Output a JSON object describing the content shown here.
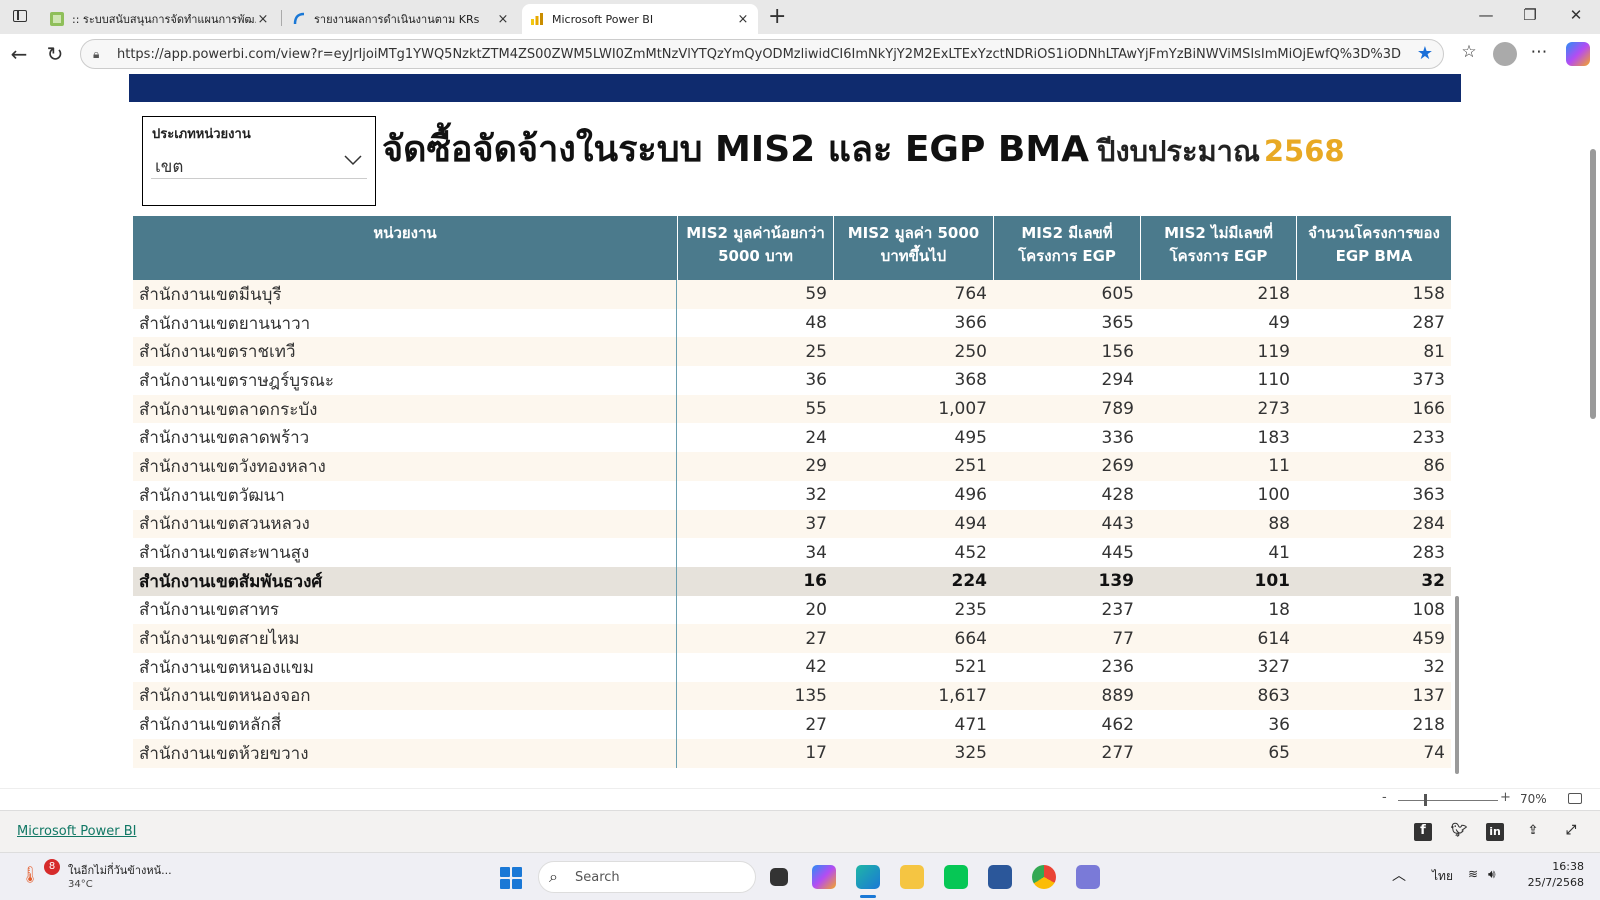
{
  "browser": {
    "tabs": [
      {
        "title": ":: ระบบสนับสนุนการจัดทำแผนการพัฒ...",
        "active": false
      },
      {
        "title": "รายงานผลการดำเนินงานตาม KRs",
        "active": false
      },
      {
        "title": "Microsoft Power BI",
        "active": true
      }
    ],
    "new_tab": "+",
    "close": "×",
    "url": "https://app.powerbi.com/view?r=eyJrIjoiMTg1YWQ5NzktZTM4ZS00ZWM5LWI0ZmMtNzVlYTQzYmQyODMzliwidCI6ImNkYjY2M2ExLTExYzctNDRiOS1iODNhLTAwYjFmYzBiNWViMSIsImMiOjEwfQ%3D%3D"
  },
  "slicer": {
    "label": "ประเภทหน่วยงาน",
    "value": "เขต"
  },
  "report_title": {
    "main": "จัดซื้อจัดจ้างในระบบ MIS2 และ EGP BMA",
    "sub": "ปีงบประมาณ",
    "year": "2568"
  },
  "table": {
    "headers": [
      "หน่วยงาน",
      "MIS2 มูลค่าน้อยกว่า 5000 บาท",
      "MIS2 มูลค่า 5000 บาทขึ้นไป",
      "MIS2 มีเลขที่โครงการ EGP",
      "MIS2 ไม่มีเลขที่โครงการ EGP",
      "จำนวนโครงการของ EGP BMA"
    ],
    "rows": [
      {
        "name": "สำนักงานเขตมีนบุรี",
        "v": [
          "59",
          "764",
          "605",
          "218",
          "158"
        ]
      },
      {
        "name": "สำนักงานเขตยานนาวา",
        "v": [
          "48",
          "366",
          "365",
          "49",
          "287"
        ]
      },
      {
        "name": "สำนักงานเขตราชเทวี",
        "v": [
          "25",
          "250",
          "156",
          "119",
          "81"
        ]
      },
      {
        "name": "สำนักงานเขตราษฎร์บูรณะ",
        "v": [
          "36",
          "368",
          "294",
          "110",
          "373"
        ]
      },
      {
        "name": "สำนักงานเขตลาดกระบัง",
        "v": [
          "55",
          "1,007",
          "789",
          "273",
          "166"
        ]
      },
      {
        "name": "สำนักงานเขตลาดพร้าว",
        "v": [
          "24",
          "495",
          "336",
          "183",
          "233"
        ]
      },
      {
        "name": "สำนักงานเขตวังทองหลาง",
        "v": [
          "29",
          "251",
          "269",
          "11",
          "86"
        ]
      },
      {
        "name": "สำนักงานเขตวัฒนา",
        "v": [
          "32",
          "496",
          "428",
          "100",
          "363"
        ]
      },
      {
        "name": "สำนักงานเขตสวนหลวง",
        "v": [
          "37",
          "494",
          "443",
          "88",
          "284"
        ]
      },
      {
        "name": "สำนักงานเขตสะพานสูง",
        "v": [
          "34",
          "452",
          "445",
          "41",
          "283"
        ]
      },
      {
        "name": "สำนักงานเขตสัมพันธวงศ์",
        "v": [
          "16",
          "224",
          "139",
          "101",
          "32"
        ],
        "highlight": true
      },
      {
        "name": "สำนักงานเขตสาทร",
        "v": [
          "20",
          "235",
          "237",
          "18",
          "108"
        ]
      },
      {
        "name": "สำนักงานเขตสายไหม",
        "v": [
          "27",
          "664",
          "77",
          "614",
          "459"
        ]
      },
      {
        "name": "สำนักงานเขตหนองแขม",
        "v": [
          "42",
          "521",
          "236",
          "327",
          "32"
        ]
      },
      {
        "name": "สำนักงานเขตหนองจอก",
        "v": [
          "135",
          "1,617",
          "889",
          "863",
          "137"
        ]
      },
      {
        "name": "สำนักงานเขตหลักสี่",
        "v": [
          "27",
          "471",
          "462",
          "36",
          "218"
        ]
      },
      {
        "name": "สำนักงานเขตห้วยขวาง",
        "v": [
          "17",
          "325",
          "277",
          "65",
          "74"
        ]
      }
    ]
  },
  "zoom": {
    "minus": "-",
    "plus": "+",
    "level": "70%"
  },
  "footer": {
    "link": "Microsoft Power BI"
  },
  "taskbar": {
    "weather_text": "ในอีกไม่กี่วันข้างหน้...",
    "weather_badge": "8",
    "temperature": "34°C",
    "search_placeholder": "Search",
    "language": "ไทย",
    "time": "16:38",
    "date": "25/7/2568"
  },
  "colors": {
    "header_band": "#0f2b6e",
    "table_header": "#4b7a8c",
    "year_accent": "#e8a923",
    "row_alt": "#fdf7ee",
    "row_highlight": "#e6e2db",
    "footer_link": "#117865"
  }
}
